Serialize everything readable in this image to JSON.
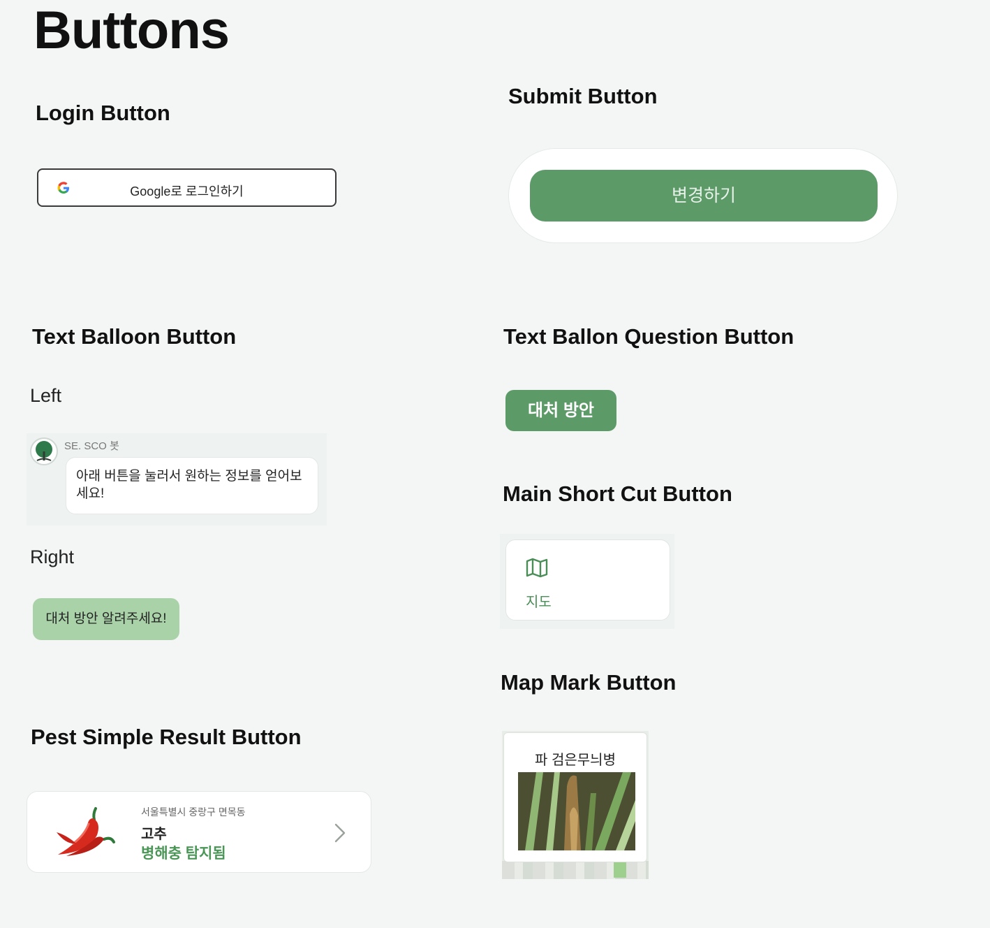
{
  "page": {
    "title": "Buttons"
  },
  "login": {
    "section_title": "Login Button",
    "button_label": "Google로 로그인하기",
    "icon": "google-g-icon"
  },
  "submit": {
    "section_title": "Submit Button",
    "button_label": "변경하기"
  },
  "text_balloon": {
    "section_title": "Text Balloon Button",
    "left_label": "Left",
    "bot_name": "SE. SCO 봇",
    "left_message": "아래 버튼을 눌러서 원하는 정보를 얻어보세요!",
    "right_label": "Right",
    "right_message": "대처 방안 알려주세요!"
  },
  "question": {
    "section_title": "Text Ballon Question Button",
    "button_label": "대처 방안"
  },
  "shortcut": {
    "section_title": "Main Short Cut Button",
    "label": "지도",
    "icon": "map-icon"
  },
  "map_mark": {
    "section_title": "Map Mark Button",
    "label": "파 검은무늬병"
  },
  "pest": {
    "section_title": "Pest Simple Result Button",
    "address": "서울특별시 중랑구 면목동",
    "crop": "고추",
    "status": "병해충 탐지됨"
  },
  "colors": {
    "primary_green": "#5c9a68",
    "light_green": "#a9d2a8",
    "status_green": "#4a9656",
    "background": "#f4f6f5"
  }
}
